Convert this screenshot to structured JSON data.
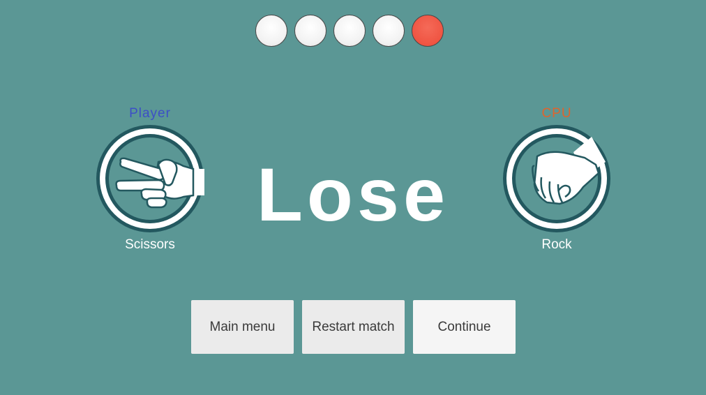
{
  "rounds": {
    "total": 5,
    "states": [
      "neutral",
      "neutral",
      "neutral",
      "neutral",
      "lost"
    ],
    "colors": {
      "neutral": "#f3f3f3",
      "lost": "#ef5442"
    }
  },
  "player": {
    "title": "Player",
    "choice": "Scissors",
    "icon": "scissors-hand-icon",
    "title_color": "#3c4fc6"
  },
  "cpu": {
    "title": "CPU",
    "choice": "Rock",
    "icon": "rock-fist-icon",
    "title_color": "#e0642c"
  },
  "result": {
    "text": "Lose"
  },
  "buttons": {
    "main_menu": "Main menu",
    "restart": "Restart match",
    "continue": "Continue"
  },
  "colors": {
    "background": "#5b9795",
    "badge_ring": "#23585f"
  }
}
